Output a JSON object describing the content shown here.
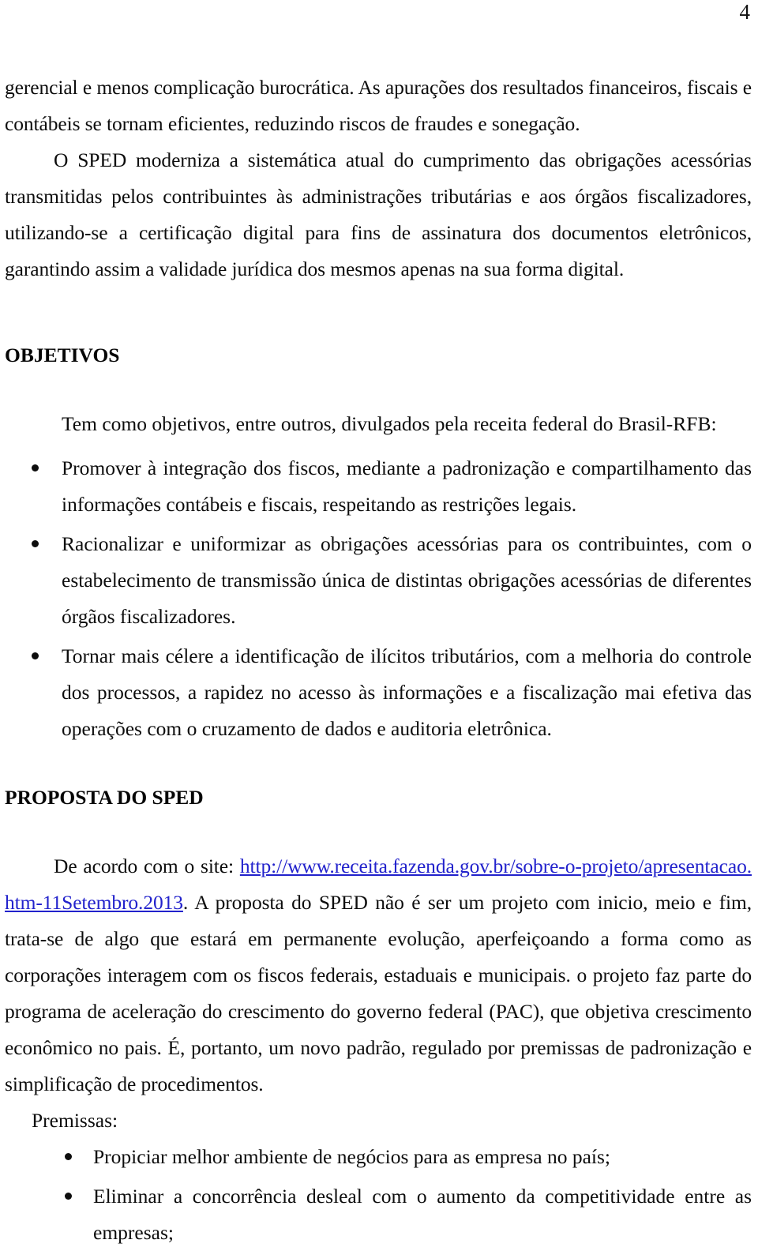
{
  "page": {
    "number": "4"
  },
  "paragraphs": {
    "p1": "gerencial e menos complicação burocrática. As apurações dos resultados financeiros, fiscais e contábeis se tornam eficientes, reduzindo riscos de fraudes e sonegação.",
    "p2": "O SPED moderniza a sistemática atual do cumprimento das obrigações acessórias transmitidas pelos contribuintes às administrações tributárias e aos órgãos fiscalizadores, utilizando-se a certificação digital para fins de assinatura dos documentos eletrônicos, garantindo assim a validade jurídica dos mesmos apenas na sua forma digital."
  },
  "objetivos": {
    "heading": "OBJETIVOS",
    "lead": "Tem como objetivos, entre outros, divulgados pela receita federal do Brasil-RFB:",
    "items": [
      "Promover à integração dos fiscos, mediante a padronização e compartilhamento das informações contábeis e fiscais, respeitando as restrições legais.",
      "Racionalizar e uniformizar as obrigações acessórias para os contribuintes, com o estabelecimento de transmissão única de distintas obrigações acessórias de diferentes órgãos fiscalizadores.",
      "Tornar mais célere a identificação de ilícitos tributários, com a melhoria do controle dos processos, a rapidez no acesso às informações e a fiscalização mai efetiva das operações com o cruzamento de dados e auditoria eletrônica."
    ]
  },
  "proposta": {
    "heading": "PROPOSTA DO SPED",
    "intro_prefix": "De acordo com o site: ",
    "link_text": "http://www.receita.fazenda.gov.br/sobre-o-projeto/apresentacao.htm-11Setembro.2013",
    "link_color": "#2222cc",
    "intro_suffix": ". A proposta do SPED não é ser um projeto com inicio, meio e fim, trata-se de algo que estará em permanente evolução, aperfeiçoando a forma como as corporações interagem com os fiscos federais, estaduais e municipais. o projeto faz parte do programa de aceleração do crescimento do governo federal (PAC), que objetiva crescimento econômico no pais. É, portanto, um novo padrão, regulado por premissas de padronização e simplificação de procedimentos.",
    "premissas_label": "Premissas:",
    "premissas_items": [
      "Propiciar melhor ambiente de negócios para as empresa no país;",
      "Eliminar a concorrência desleal com o aumento da competitividade entre as empresas;"
    ]
  }
}
